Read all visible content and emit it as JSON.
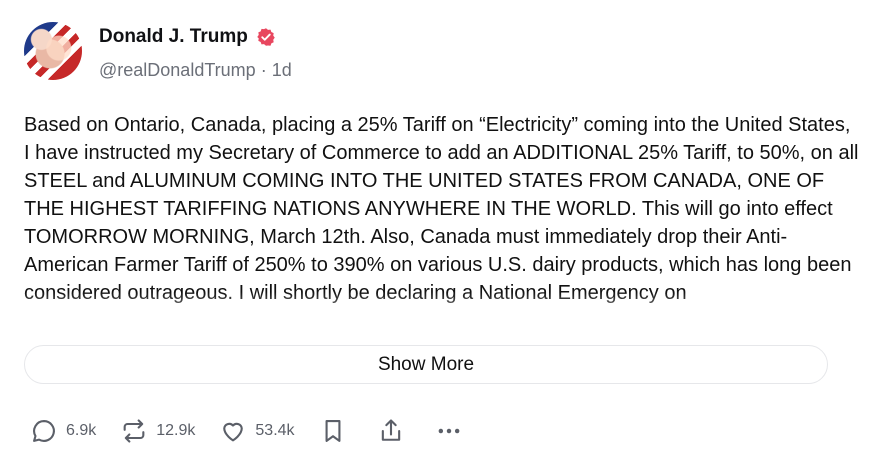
{
  "post": {
    "author_name": "Donald J. Trump",
    "handle": "@realDonaldTrump",
    "separator": "·",
    "time": "1d",
    "text": "Based on Ontario, Canada, placing a 25% Tariff on “Electricity” coming into the United States, I have instructed my Secretary of Commerce to add an ADDITIONAL 25% Tariff, to 50%, on all STEEL and ALUMINUM COMING INTO THE UNITED STATES FROM CANADA, ONE OF THE HIGHEST TARIFFING NATIONS ANYWHERE IN THE WORLD. This will go into effect TOMORROW MORNING, March 12th. Also, Canada must immediately drop their Anti-American Farmer Tariff of 250% to 390% on various U.S. dairy products, which has long been considered outrageous. I will shortly be declaring a National Emergency on",
    "show_more_label": "Show More"
  },
  "actions": {
    "replies": "6.9k",
    "reposts": "12.9k",
    "likes": "53.4k"
  },
  "colors": {
    "verified": "#e8475f",
    "muted": "#6b6f78"
  },
  "icons": [
    "avatar",
    "verified-badge-icon",
    "reply-icon",
    "repost-icon",
    "like-icon",
    "bookmark-icon",
    "share-icon",
    "more-icon"
  ]
}
